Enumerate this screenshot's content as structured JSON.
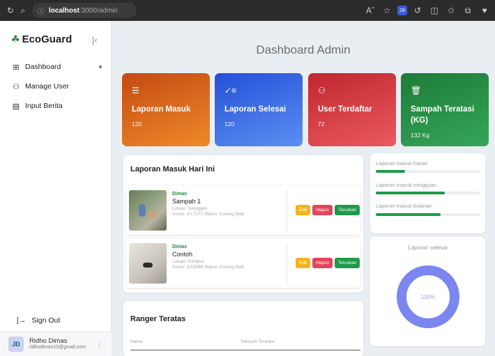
{
  "browser": {
    "url_host": "localhost",
    "url_path": ":3000/admin",
    "badge": "28"
  },
  "sidebar": {
    "brand": "EcoGuard",
    "items": [
      {
        "label": "Dashboard",
        "icon": "grid-icon"
      },
      {
        "label": "Manage User",
        "icon": "users-icon"
      },
      {
        "label": "Input Berita",
        "icon": "news-icon"
      }
    ],
    "signout": "Sign Out",
    "user": {
      "initials": "JD",
      "name": "Ridho Dimas",
      "email": "ridhodimas10@gmail.com"
    }
  },
  "main": {
    "title": "Dashboard Admin",
    "cards": [
      {
        "label": "Laporan Masuk",
        "value": "120",
        "icon": "list-icon",
        "color": "#e06b1e"
      },
      {
        "label": "Laporan Selesai",
        "value": "120",
        "icon": "checklist-icon",
        "color": "#3a6ee6"
      },
      {
        "label": "User Terdaftar",
        "value": "72",
        "icon": "user-group-icon",
        "color": "#d9393f"
      },
      {
        "label": "Sampah Teratasi (KG)",
        "value": "132 Kg",
        "icon": "trash-icon",
        "color": "#268f48"
      }
    ],
    "reports": {
      "title": "Laporan Masuk Hari Ini",
      "items": [
        {
          "user": "Dimas",
          "title": "Sampah 1",
          "location": "Lokasi: Nanggalo",
          "meta": "Score: 10.7172   Status: Kurang Baik"
        },
        {
          "user": "Dimas",
          "title": "Contoh",
          "location": "Lokasi: Kampus",
          "meta": "Score: 3.53388   Status: Kurang Baik"
        }
      ],
      "actions": {
        "edit": "Edit",
        "hapus": "Hapus",
        "teruskan": "Teruskan"
      }
    },
    "ranger": {
      "title": "Ranger Teratas",
      "col_name": "Nama",
      "col_trash": "Sampah Teratasi"
    },
    "progress": [
      {
        "label": "Laporan masuk harian",
        "fraction": 0.28
      },
      {
        "label": "Laporan masuk mingguan",
        "fraction": 0.66
      },
      {
        "label": "Laporan masuk bulanan",
        "fraction": 0.62
      }
    ],
    "donut": {
      "title": "Laporan selesai",
      "value_label": "100%",
      "fraction": 1.0,
      "color": "#7b86f0"
    }
  }
}
